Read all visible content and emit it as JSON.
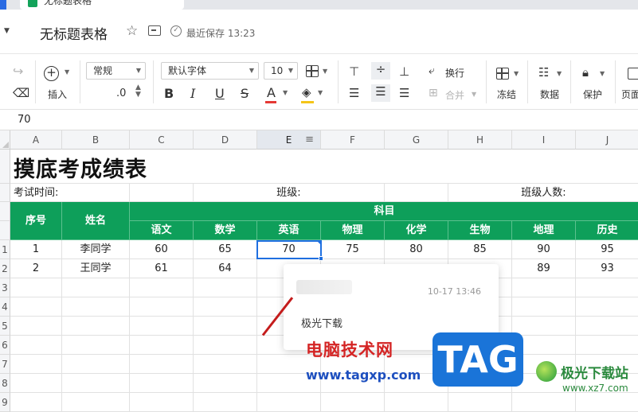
{
  "tab": {
    "title": "无标题表格"
  },
  "titlebar": {
    "doc_title": "无标题表格",
    "save_status": "最近保存 13:23"
  },
  "toolbar": {
    "insert_label": "插入",
    "number_format": "常规",
    "font_family": "默认字体",
    "font_size": "10",
    "decimal": ".0",
    "wrap_label": "换行",
    "merge_label": "合并",
    "freeze_label": "冻结",
    "data_label": "数据",
    "protect_label": "保护",
    "page_label": "页面",
    "bold": "B",
    "italic": "I",
    "underline": "U",
    "strike": "S",
    "font_color": "A",
    "font_color_hex": "#e53935",
    "fill_color_hex": "#f5c518"
  },
  "formula_bar": {
    "value": "70"
  },
  "columns": [
    "A",
    "B",
    "C",
    "D",
    "E",
    "F",
    "G",
    "H",
    "I",
    "J"
  ],
  "rows": [
    "1",
    "2",
    "3",
    "4",
    "5",
    "6",
    "7",
    "8",
    "9"
  ],
  "sheet": {
    "title": "摸底考成绩表",
    "exam_time_label": "考试时间:",
    "class_label": "班级:",
    "class_size_label": "班级人数:",
    "header_no": "序号",
    "header_name": "姓名",
    "header_subjects": "科目",
    "subjects": [
      "语文",
      "数学",
      "英语",
      "物理",
      "化学",
      "生物",
      "地理",
      "历史"
    ],
    "students": [
      {
        "no": "1",
        "name": "李同学",
        "scores": [
          "60",
          "65",
          "70",
          "75",
          "80",
          "85",
          "90",
          "95"
        ]
      },
      {
        "no": "2",
        "name": "王同学",
        "scores": [
          "61",
          "64",
          "",
          "",
          "",
          "",
          "89",
          "93"
        ]
      }
    ],
    "header_color": "#0e9f5a"
  },
  "comment": {
    "time": "10-17 13:46",
    "text": "极光下载"
  },
  "watermark": {
    "site_name": "电脑技术网",
    "site_url": "www.tagxp.com",
    "tag": "TAG",
    "brand": "极光下载站",
    "brand_url": "www.xz7.com"
  }
}
